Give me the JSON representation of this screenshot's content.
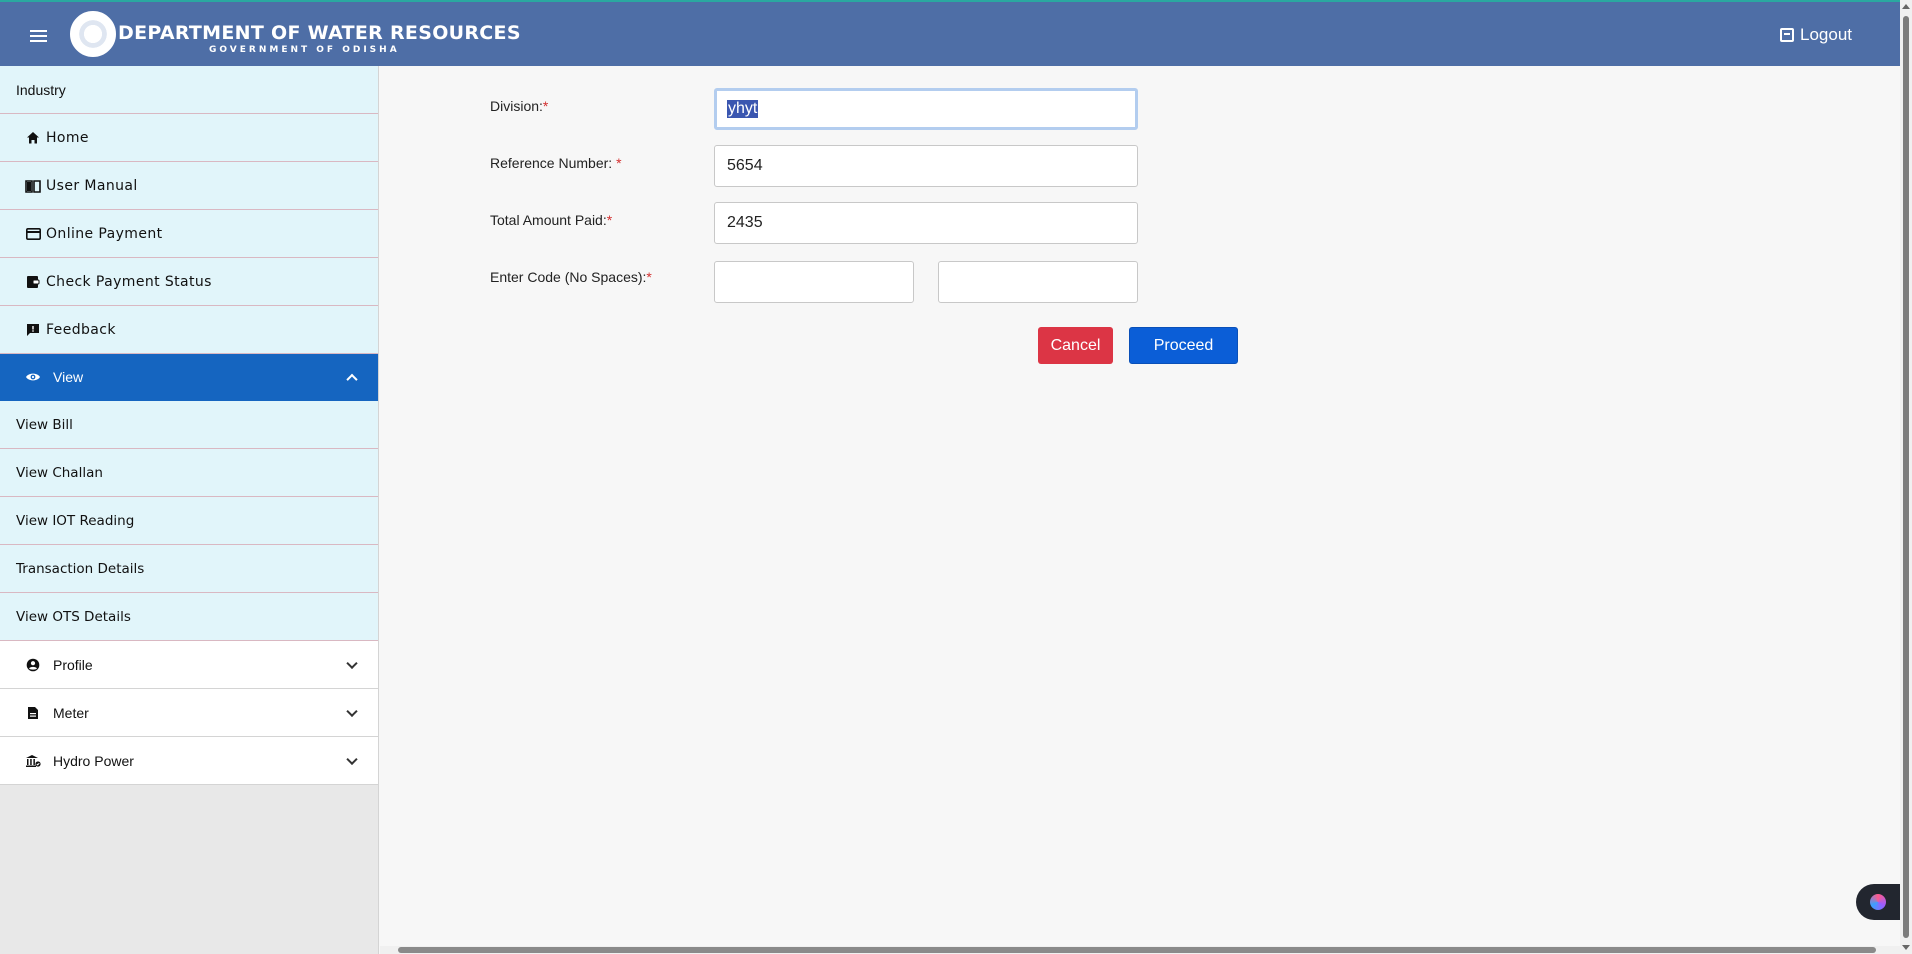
{
  "header": {
    "title": "DEPARTMENT OF WATER RESOURCES",
    "subtitle": "GOVERNMENT OF ODISHA",
    "logout_label": "Logout",
    "background": "#4e6ea6"
  },
  "sidebar": {
    "section_label": "Industry",
    "items": [
      {
        "label": "Home",
        "icon": "home-icon"
      },
      {
        "label": "User Manual",
        "icon": "book-icon"
      },
      {
        "label": "Online Payment",
        "icon": "credit-card-icon"
      },
      {
        "label": "Check Payment Status",
        "icon": "receipt-icon"
      },
      {
        "label": "Feedback",
        "icon": "feedback-icon"
      }
    ],
    "active_group": {
      "label": "View",
      "icon": "eye-icon",
      "color": "#1565c0"
    },
    "view_items": [
      {
        "label": "View Bill"
      },
      {
        "label": "View Challan"
      },
      {
        "label": "View IOT Reading"
      },
      {
        "label": "Transaction Details"
      },
      {
        "label": "View OTS Details"
      }
    ],
    "groups": [
      {
        "label": "Profile",
        "icon": "user-circle-icon"
      },
      {
        "label": "Meter",
        "icon": "document-icon"
      },
      {
        "label": "Hydro Power",
        "icon": "building-icon"
      }
    ]
  },
  "form": {
    "division_label": "Division:",
    "division_value": "yhyt",
    "reference_label": "Reference Number: ",
    "reference_value": "5654",
    "amount_label": "Total Amount Paid:",
    "amount_value": "2435",
    "code_label": "Enter Code (No Spaces):",
    "code_value": "",
    "code_input_value": "",
    "required_mark": "*"
  },
  "buttons": {
    "cancel_label": "Cancel",
    "proceed_label": "Proceed",
    "cancel_color": "#dc3545",
    "proceed_color": "#0b5ed7"
  }
}
